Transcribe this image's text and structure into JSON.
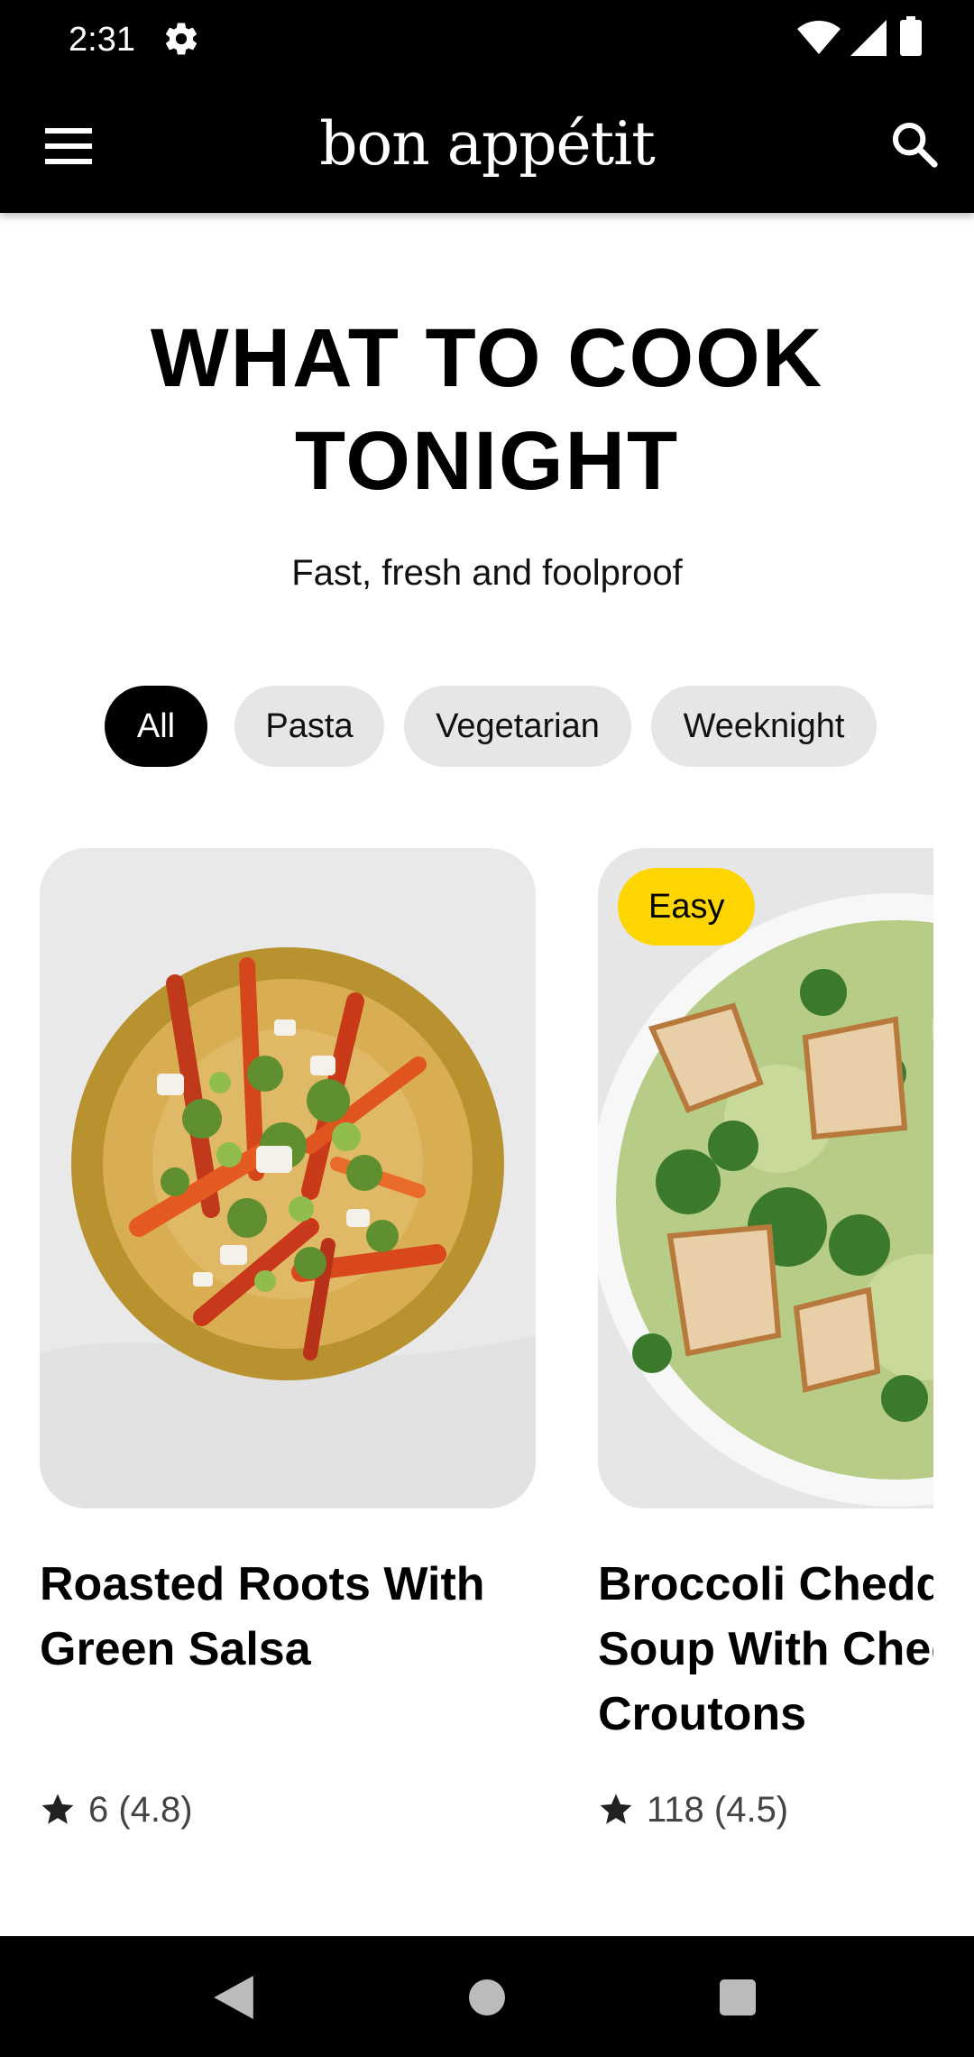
{
  "status_bar": {
    "time": "2:31",
    "icons": [
      "gear-icon",
      "wifi-icon",
      "signal-icon",
      "battery-icon"
    ]
  },
  "app_bar": {
    "brand": "bon appétit",
    "left_icon": "menu-icon",
    "right_icon": "search-icon"
  },
  "hero": {
    "title": "WHAT TO COOK TONIGHT",
    "subtitle": "Fast, fresh and foolproof"
  },
  "filters": {
    "chips": [
      {
        "label": "All",
        "selected": true
      },
      {
        "label": "Pasta",
        "selected": false
      },
      {
        "label": "Vegetarian",
        "selected": false
      },
      {
        "label": "Weeknight",
        "selected": false
      }
    ]
  },
  "recipes": [
    {
      "title": "Roasted Roots With Green Salsa",
      "rating": "6 (4.8)",
      "badge": ""
    },
    {
      "title": "Broccoli Cheddar Soup With Cheesy Croutons",
      "rating": "118 (4.5)",
      "badge": "Easy"
    }
  ],
  "nav_bar": {
    "icons": [
      "back-icon",
      "home-icon",
      "recents-icon"
    ]
  },
  "colors": {
    "bar_background": "#000000",
    "chip_active": "#000000",
    "chip_inactive": "#e6e6e6",
    "badge": "#ffd500"
  }
}
